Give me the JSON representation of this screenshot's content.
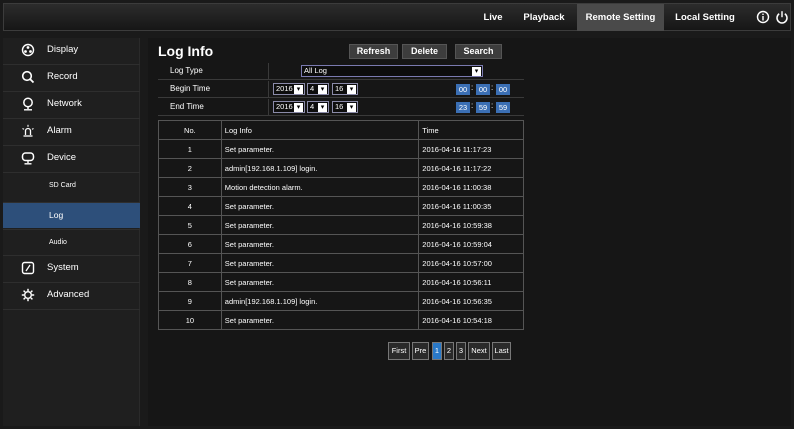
{
  "topnav": {
    "items": [
      {
        "label": "Live",
        "active": false
      },
      {
        "label": "Playback",
        "active": false
      },
      {
        "label": "Remote Setting",
        "active": true
      },
      {
        "label": "Local Setting",
        "active": false
      }
    ],
    "icons": [
      "info-icon",
      "power-icon"
    ]
  },
  "sidebar": {
    "items": [
      {
        "label": "Display",
        "icon": "display-icon"
      },
      {
        "label": "Record",
        "icon": "record-icon"
      },
      {
        "label": "Network",
        "icon": "network-icon"
      },
      {
        "label": "Alarm",
        "icon": "alarm-icon"
      },
      {
        "label": "Device",
        "icon": "device-icon"
      },
      {
        "label": "System",
        "icon": "system-icon"
      },
      {
        "label": "Advanced",
        "icon": "advanced-icon"
      }
    ],
    "subitems": [
      {
        "label": "SD Card",
        "active": false
      },
      {
        "label": "Log",
        "active": true
      },
      {
        "label": "Audio",
        "active": false
      }
    ]
  },
  "panel": {
    "title": "Log Info",
    "buttons": {
      "refresh": "Refresh",
      "delete": "Delete",
      "search": "Search"
    }
  },
  "filter": {
    "log_type_label": "Log Type",
    "log_type_value": "All Log",
    "begin_label": "Begin Time",
    "end_label": "End Time",
    "begin": {
      "year": "2016",
      "month": "4",
      "day": "16",
      "hh": "00",
      "mm": "00",
      "ss": "00"
    },
    "end": {
      "year": "2016",
      "month": "4",
      "day": "16",
      "hh": "23",
      "mm": "59",
      "ss": "59"
    }
  },
  "table": {
    "headers": [
      "No.",
      "Log Info",
      "Time"
    ],
    "rows": [
      [
        "1",
        "Set parameter.",
        "2016-04-16 11:17:23"
      ],
      [
        "2",
        "admin[192.168.1.109] login.",
        "2016-04-16 11:17:22"
      ],
      [
        "3",
        "Motion detection alarm.",
        "2016-04-16 11:00:38"
      ],
      [
        "4",
        "Set parameter.",
        "2016-04-16 11:00:35"
      ],
      [
        "5",
        "Set parameter.",
        "2016-04-16 10:59:38"
      ],
      [
        "6",
        "Set parameter.",
        "2016-04-16 10:59:04"
      ],
      [
        "7",
        "Set parameter.",
        "2016-04-16 10:57:00"
      ],
      [
        "8",
        "Set parameter.",
        "2016-04-16 10:56:11"
      ],
      [
        "9",
        "admin[192.168.1.109] login.",
        "2016-04-16 10:56:35"
      ],
      [
        "10",
        "Set parameter.",
        "2016-04-16 10:54:18"
      ]
    ]
  },
  "pagination": {
    "first": "First",
    "prev": "Pre",
    "pages": [
      "1",
      "2",
      "3"
    ],
    "current": "1",
    "next": "Next",
    "last": "Last"
  },
  "colors": {
    "accent": "#2a79c8",
    "active_sidebar": "#2d4f7a",
    "timebox": "#3b6fb4"
  }
}
